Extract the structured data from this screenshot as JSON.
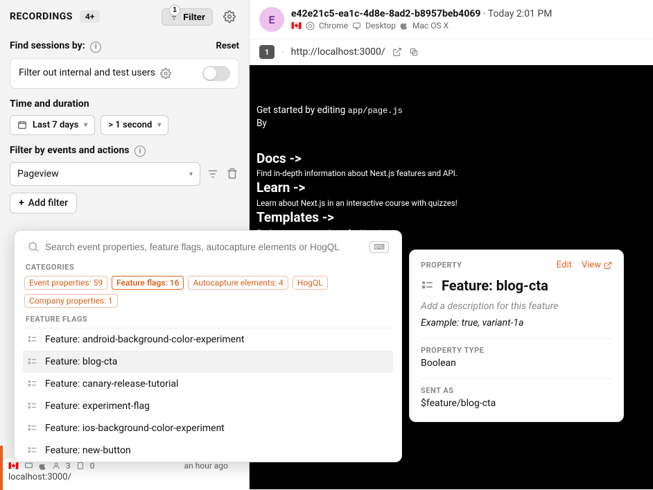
{
  "sidebar": {
    "title": "RECORDINGS",
    "count": "4+",
    "filter_button": "Filter",
    "filter_badge": "1",
    "find_label": "Find sessions by:",
    "reset": "Reset",
    "filter_row_label": "Filter out internal and test users",
    "time_title": "Time and duration",
    "date_chip": "Last 7 days",
    "duration_chip": "> 1 second",
    "events_title": "Filter by events and actions",
    "event_select": "Pageview",
    "add_filter": "Add filter"
  },
  "session": {
    "avatar": "E",
    "id": "e42e21c5-ea1c-4d8e-8ad2-b8957beb4069",
    "time": "Today 2:01 PM",
    "flag": "🇨🇦",
    "browser": "Chrome",
    "device": "Desktop",
    "os": "Mac OS X",
    "url_badge": "1",
    "url": "http://localhost:3000/"
  },
  "playback": {
    "line1a": "Get started by editing ",
    "line1b": "app/page.js",
    "line2": "By",
    "docs": "Docs ->",
    "docs_sub": "Find in-depth information about Next.js features and API.",
    "learn": "Learn ->",
    "learn_sub": "Learn about Next.js in an interactive course with quizzes!",
    "templates": "Templates ->",
    "templates_sub": "Explore starter templates for Next.js."
  },
  "popover": {
    "placeholder": "Search event properties, feature flags, autocapture elements or HogQL",
    "categories_label": "CATEGORIES",
    "ff_label": "FEATURE FLAGS",
    "categories": [
      {
        "label": "Event properties: 59"
      },
      {
        "label": "Feature flags: 16"
      },
      {
        "label": "Autocapture elements: 4"
      },
      {
        "label": "HogQL"
      },
      {
        "label": "Company properties: 1"
      }
    ],
    "flags": [
      "Feature: android-background-color-experiment",
      "Feature: blog-cta",
      "Feature: canary-release-tutorial",
      "Feature: experiment-flag",
      "Feature: ios-background-color-experiment",
      "Feature: new-button"
    ]
  },
  "card": {
    "property_label": "PROPERTY",
    "edit": "Edit",
    "view": "View",
    "title": "Feature: blog-cta",
    "desc": "Add a description for this feature",
    "example": "Example: true, variant-1a",
    "type_label": "PROPERTY TYPE",
    "type_value": "Boolean",
    "sent_label": "SENT AS",
    "sent_value": "$feature/blog-cta"
  },
  "bottom": {
    "flag": "🇨🇦",
    "people": "3",
    "pages": "0",
    "time": "an hour ago",
    "url": "localhost:3000/"
  }
}
